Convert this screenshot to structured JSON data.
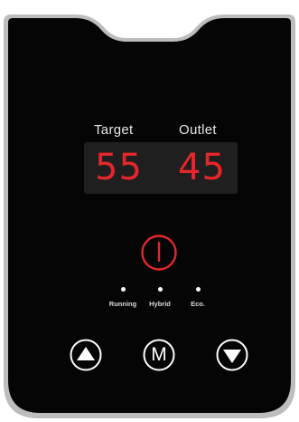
{
  "display": {
    "target_label": "Target",
    "outlet_label": "Outlet",
    "target_value": "55",
    "outlet_value": "45"
  },
  "indicators": {
    "running": "Running",
    "hybrid": "Hybrid",
    "eco": "Eco."
  },
  "buttons": {
    "mode_label": "M",
    "up_icon": "triangle-up-icon",
    "down_icon": "triangle-down-icon",
    "power_icon": "power-icon"
  },
  "colors": {
    "panel": "#050505",
    "frame": "#bdbdbd",
    "digits": "#e6262b",
    "power": "#e6262b",
    "display_window": "#1f1f1f"
  }
}
